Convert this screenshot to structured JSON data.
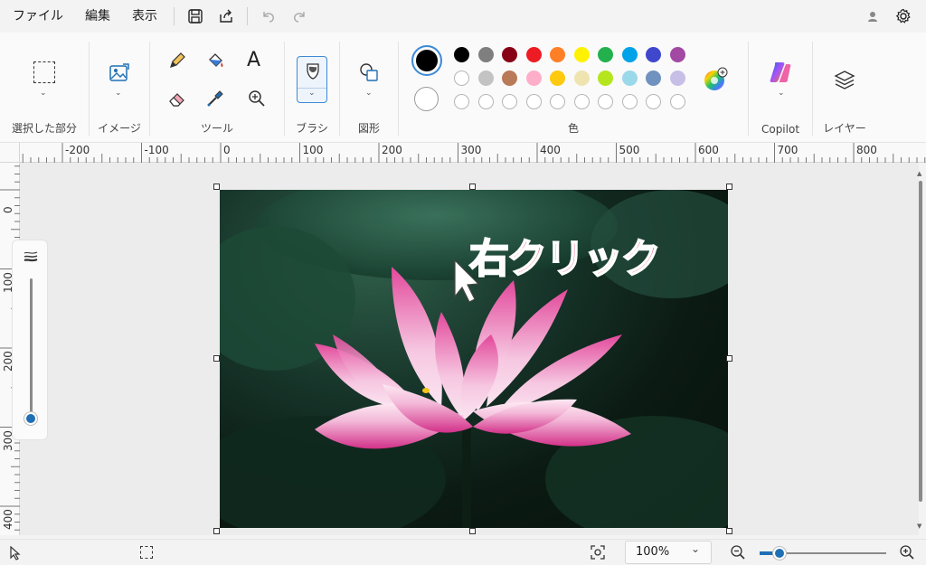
{
  "menu": {
    "file": "ファイル",
    "edit": "編集",
    "view": "表示"
  },
  "ribbon": {
    "selection_label": "選択した部分",
    "image_label": "イメージ",
    "tools_label": "ツール",
    "brush_label": "ブラシ",
    "shapes_label": "図形",
    "color_label": "色",
    "copilot_label": "Copilot",
    "layers_label": "レイヤー",
    "text_tool_glyph": "A"
  },
  "palette": {
    "primary": "#000000",
    "secondary": "#ffffff",
    "row1": [
      "#000000",
      "#7f7f7f",
      "#880015",
      "#ed1c24",
      "#ff7f27",
      "#fff200",
      "#22b14c",
      "#00a2e8",
      "#3f48cc",
      "#a349a4"
    ],
    "row2": [
      "#ffffff",
      "#c3c3c3",
      "#b97a57",
      "#ffaec9",
      "#ffc90e",
      "#efe4b0",
      "#b5e61d",
      "#99d9ea",
      "#7092be",
      "#c8bfe7"
    ],
    "row3_empty": 10
  },
  "ruler": {
    "h_labels": [
      "-200",
      "-100",
      "0",
      "100",
      "200",
      "300",
      "400",
      "500",
      "600",
      "700",
      "800"
    ],
    "v_labels": [
      "0",
      "100",
      "200",
      "300",
      "400"
    ]
  },
  "canvas": {
    "overlay_text": "右クリック",
    "overlay_color": "#e8306a"
  },
  "status": {
    "zoom": "100%"
  }
}
